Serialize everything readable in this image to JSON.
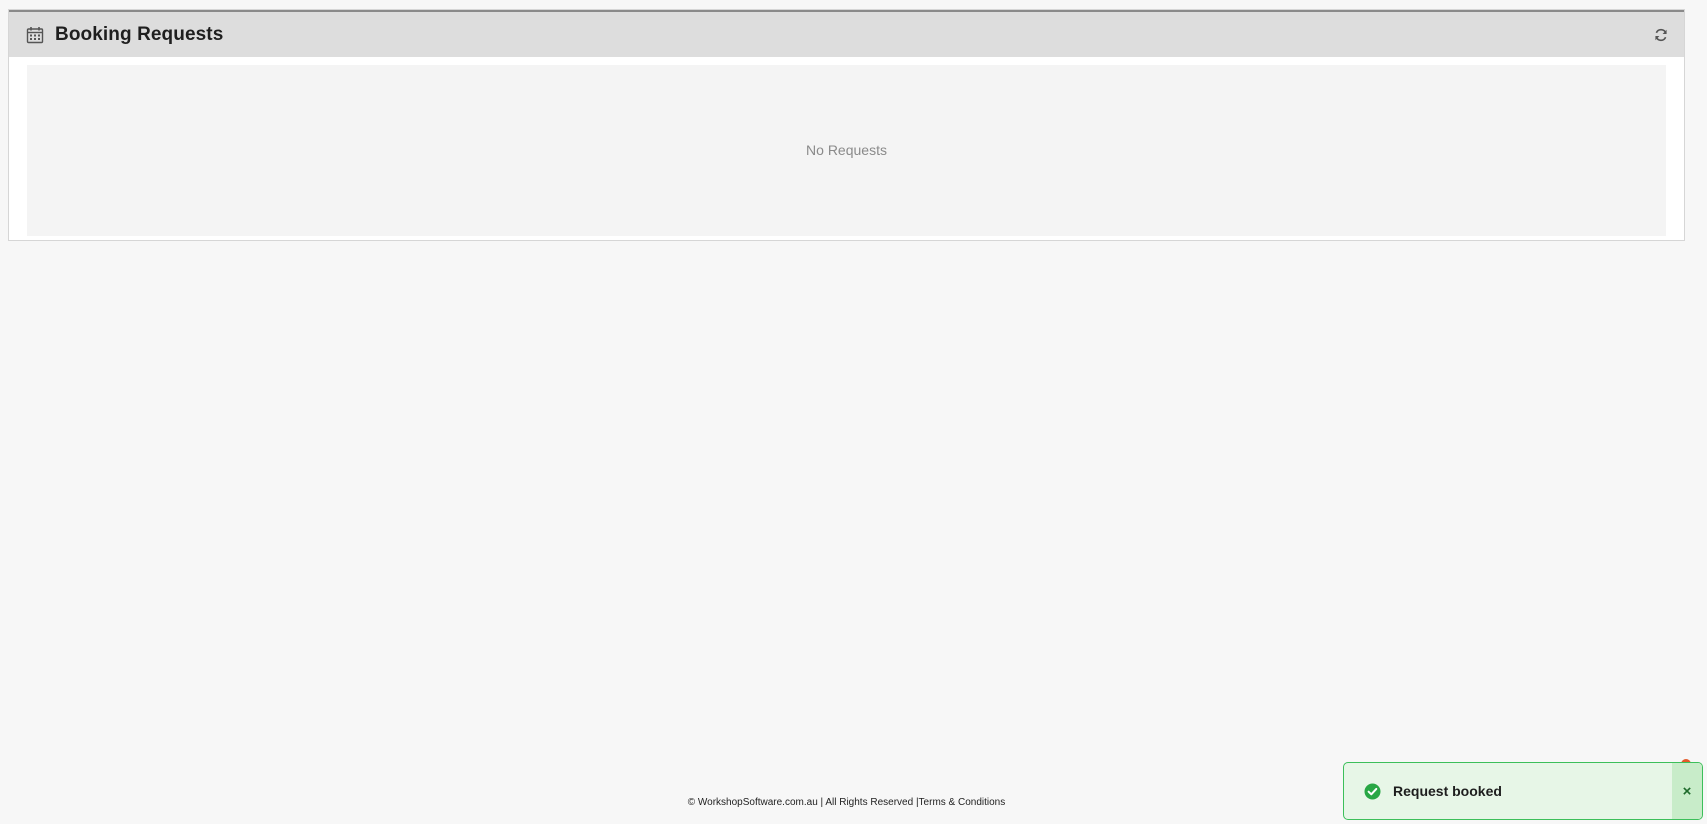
{
  "panel": {
    "title": "Booking Requests",
    "header_icon": "calendar-icon",
    "refresh_icon": "refresh-icon",
    "empty_message": "No Requests"
  },
  "footer": {
    "copyright": "© WorkshopSoftware.com.au | All Rights Reserved |",
    "terms_link": "Terms & Conditions"
  },
  "toast": {
    "message": "Request booked",
    "status_icon": "check-circle-icon",
    "close_label": "×"
  },
  "colors": {
    "success_green": "#28a745",
    "toast_bg": "#e7f6e7",
    "header_bg": "#dddddd"
  }
}
